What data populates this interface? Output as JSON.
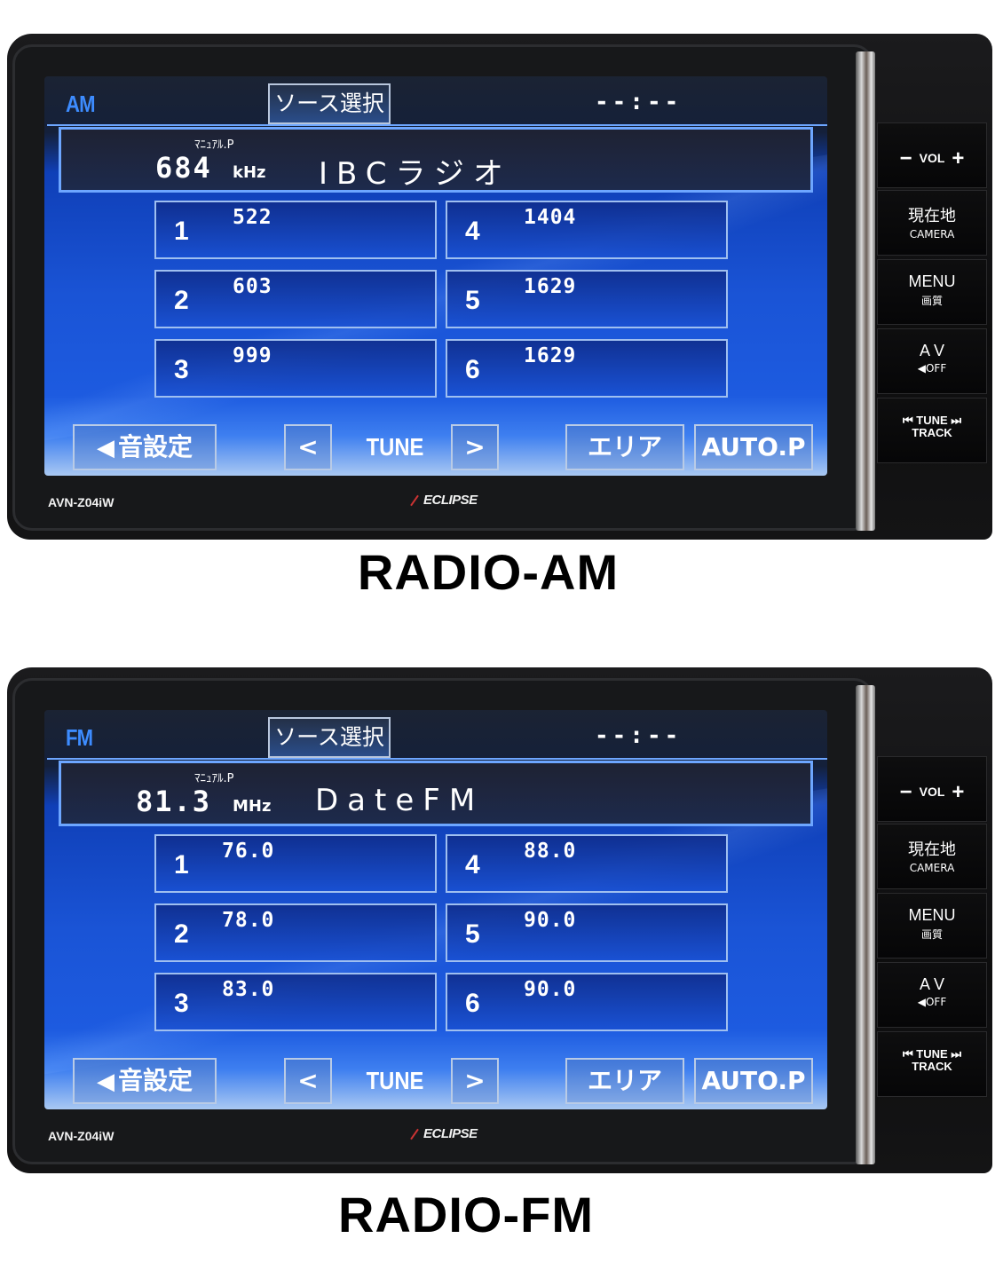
{
  "units": [
    {
      "id": "am",
      "band": "AM",
      "source_select": "ソース選択",
      "clock": "--:--",
      "preset_mode": "ﾏﾆｭｱﾙ.P",
      "frequency": "684",
      "frequency_unit": "kHz",
      "station_name": "IBCラジオ",
      "presets": [
        {
          "num": "1",
          "freq": "522"
        },
        {
          "num": "2",
          "freq": "603"
        },
        {
          "num": "3",
          "freq": "999"
        },
        {
          "num": "4",
          "freq": "1404"
        },
        {
          "num": "5",
          "freq": "1629"
        },
        {
          "num": "6",
          "freq": "1629"
        }
      ],
      "sound_settings": "音設定",
      "tune_prev": "<",
      "tune_label": "TUNE",
      "tune_next": ">",
      "area": "エリア",
      "auto_preset": "AUTO.P",
      "model": "AVN-Z04iW",
      "brand": "ECLIPSE",
      "caption": "RADIO-AM"
    },
    {
      "id": "fm",
      "band": "FM",
      "source_select": "ソース選択",
      "clock": "--:--",
      "preset_mode": "ﾏﾆｭｱﾙ.P",
      "frequency": "81.3",
      "frequency_unit": "MHz",
      "station_name": "DateFM",
      "presets": [
        {
          "num": "1",
          "freq": "76.0"
        },
        {
          "num": "2",
          "freq": "78.0"
        },
        {
          "num": "3",
          "freq": "83.0"
        },
        {
          "num": "4",
          "freq": "88.0"
        },
        {
          "num": "5",
          "freq": "90.0"
        },
        {
          "num": "6",
          "freq": "90.0"
        }
      ],
      "sound_settings": "音設定",
      "tune_prev": "<",
      "tune_label": "TUNE",
      "tune_next": ">",
      "area": "エリア",
      "auto_preset": "AUTO.P",
      "model": "AVN-Z04iW",
      "brand": "ECLIPSE",
      "caption": "RADIO-FM"
    }
  ],
  "hardware_buttons": {
    "vol_minus": "−",
    "vol": "VOL",
    "vol_plus": "+",
    "current_location": "現在地",
    "camera": "CAMERA",
    "menu": "MENU",
    "picture_quality": "画質",
    "av": "A V",
    "mute_off": "◀OFF",
    "tune": "TUNE",
    "track": "TRACK",
    "prev_icon": "⏮",
    "next_icon": "⏭"
  },
  "colors": {
    "band_label": "#3d8cff",
    "screen_blue": "#1a54d6",
    "panel_border": "#6da6ff"
  }
}
